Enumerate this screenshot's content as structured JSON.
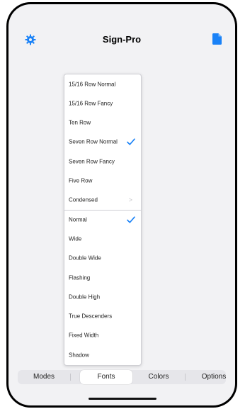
{
  "header": {
    "title": "Sign-Pro",
    "settings_icon": "gear-icon",
    "document_icon": "document-icon",
    "accent_color": "#1a82f7"
  },
  "menu": {
    "items": [
      {
        "label": "15/16 Row Normal",
        "checked": false,
        "submenu": false
      },
      {
        "label": "15/16 Row Fancy",
        "checked": false,
        "submenu": false
      },
      {
        "label": "Ten Row",
        "checked": false,
        "submenu": false
      },
      {
        "label": "Seven Row Normal",
        "checked": true,
        "submenu": false
      },
      {
        "label": "Seven Row Fancy",
        "checked": false,
        "submenu": false
      },
      {
        "label": "Five Row",
        "checked": false,
        "submenu": false
      },
      {
        "label": "Condensed",
        "checked": false,
        "submenu": true
      },
      {
        "label": "Normal",
        "checked": true,
        "submenu": false
      },
      {
        "label": "Wide",
        "checked": false,
        "submenu": false
      },
      {
        "label": "Double Wide",
        "checked": false,
        "submenu": false
      },
      {
        "label": "Flashing",
        "checked": false,
        "submenu": false
      },
      {
        "label": "Double High",
        "checked": false,
        "submenu": false
      },
      {
        "label": "True Descenders",
        "checked": false,
        "submenu": false
      },
      {
        "label": "Fixed Width",
        "checked": false,
        "submenu": false
      },
      {
        "label": "Shadow",
        "checked": false,
        "submenu": false
      }
    ],
    "chevron": ">"
  },
  "tabs": [
    {
      "label": "Modes",
      "active": false
    },
    {
      "label": "Fonts",
      "active": true
    },
    {
      "label": "Colors",
      "active": false
    },
    {
      "label": "Options",
      "active": false
    }
  ]
}
